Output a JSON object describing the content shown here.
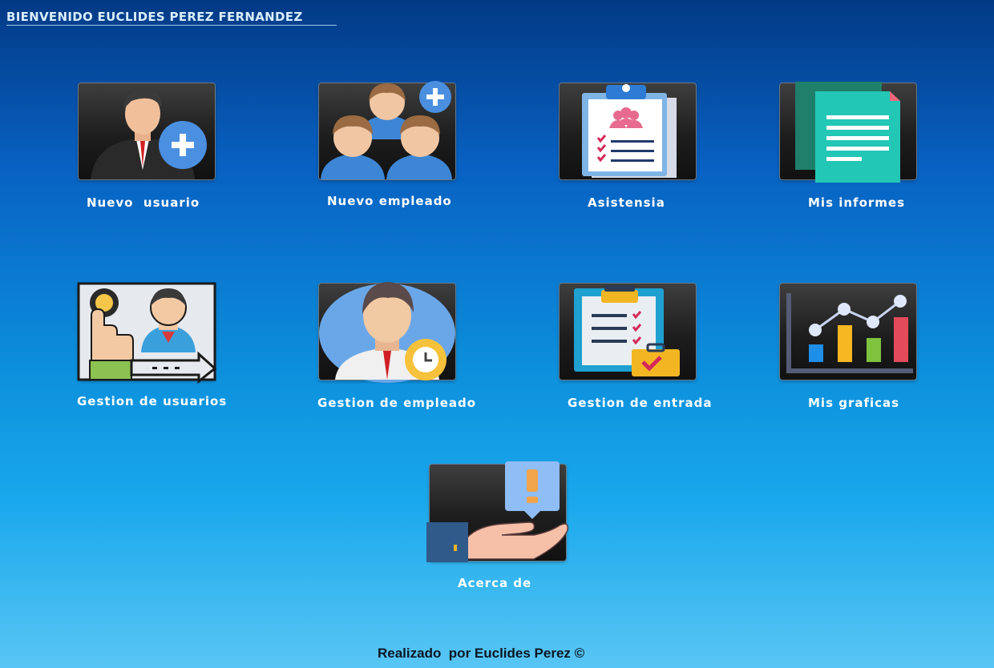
{
  "header": {
    "welcome": "BIENVENIDO EUCLIDES PEREZ FERNANDEZ"
  },
  "menu": {
    "nuevo_usuario": "Nuevo  usuario",
    "nuevo_empleado": "Nuevo empleado",
    "asistensia": "Asistensia",
    "mis_informes": "Mis informes",
    "gestion_usuarios": "Gestion de usuarios",
    "gestion_empleado": "Gestion de empleado",
    "gestion_entrada": "Gestion de entrada",
    "mis_graficas": "Mis graficas",
    "acerca_de": "Acerca de"
  },
  "footer": {
    "credit": "Realizado  por Euclides Perez ©"
  },
  "icons": {
    "nuevo_usuario": "user-add-icon",
    "nuevo_empleado": "employees-add-icon",
    "asistensia": "attendance-clipboard-icon",
    "mis_informes": "documents-icon",
    "gestion_usuarios": "user-management-icon",
    "gestion_empleado": "employee-settings-icon",
    "gestion_entrada": "entry-checklist-icon",
    "mis_graficas": "bar-line-chart-icon",
    "acerca_de": "about-info-icon"
  },
  "colors": {
    "accent_blue": "#4a8fe0",
    "text_white": "#ffffff"
  }
}
